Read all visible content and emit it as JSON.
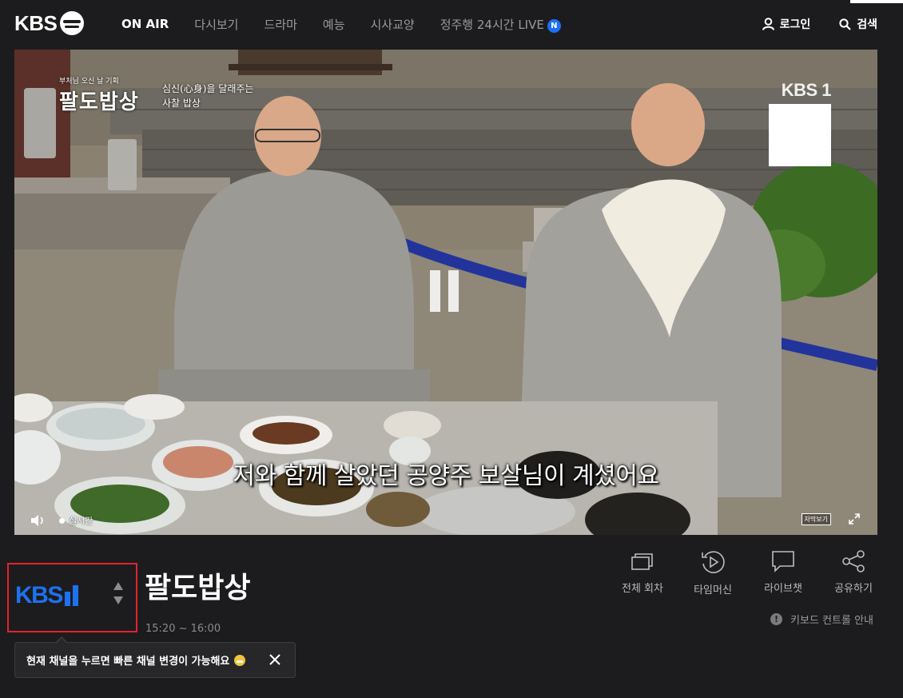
{
  "header": {
    "logo_text": "KBS",
    "nav": [
      {
        "label": "ON AIR",
        "active": true
      },
      {
        "label": "다시보기"
      },
      {
        "label": "드라마"
      },
      {
        "label": "예능"
      },
      {
        "label": "시사교양"
      },
      {
        "label": "정주행 24시간 LIVE",
        "badge": "N"
      }
    ],
    "login_label": "로그인",
    "search_label": "검색"
  },
  "player": {
    "overlay_small": "부처님 오신 날 기획",
    "overlay_title": "팔도밥상",
    "overlay_tag_line1": "심신(心身)을 달래주는",
    "overlay_tag_line2": "사찰 밥상",
    "watermark": "KBS 1",
    "subtitle": "저와 함께 살았던 공양주 보살님이 계셨어요",
    "live_label": "실시간",
    "cc_label": "자막보기"
  },
  "channel": {
    "logo_text": "KBS"
  },
  "program": {
    "title": "팔도밥상",
    "time": "15:20 ~ 16:00"
  },
  "actions": [
    {
      "label": "전체 회차",
      "icon": "episodes-icon"
    },
    {
      "label": "타임머신",
      "icon": "timemachine-icon"
    },
    {
      "label": "라이브챗",
      "icon": "livechat-icon"
    },
    {
      "label": "공유하기",
      "icon": "share-icon"
    }
  ],
  "keyboard_guide": "키보드 컨트롤 안내",
  "tooltip": {
    "text": "현재 채널을 누르면 빠른 채널 변경이 가능해요"
  },
  "colors": {
    "accent_blue": "#1d72f0",
    "highlight_red": "#e0242b",
    "background": "#1c1c1e"
  }
}
